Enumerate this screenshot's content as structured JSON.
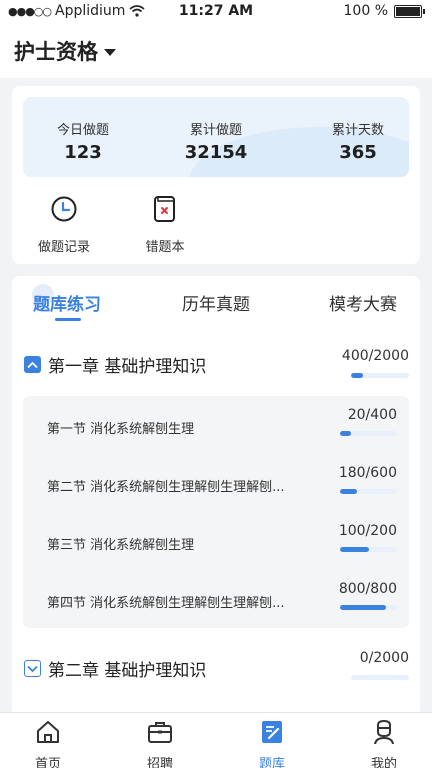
{
  "status_bar": {
    "carrier": "Applidium",
    "time": "11:27 AM",
    "battery": "100 %"
  },
  "header": {
    "title": "护士资格"
  },
  "stats": [
    {
      "label": "今日做题",
      "value": "123"
    },
    {
      "label": "累计做题",
      "value": "32154"
    },
    {
      "label": "累计天数",
      "value": "365"
    }
  ],
  "tools": [
    {
      "label": "做题记录",
      "icon": "clock-icon"
    },
    {
      "label": "错题本",
      "icon": "wrong-book-icon"
    }
  ],
  "tabs": [
    {
      "label": "题库练习",
      "active": true
    },
    {
      "label": "历年真题",
      "active": false
    },
    {
      "label": "模考大赛",
      "active": false
    }
  ],
  "chapters": [
    {
      "title": "第一章 基础护理知识",
      "progress": "400/2000",
      "fraction": 0.2,
      "expanded": true,
      "sections": [
        {
          "title": "第一节 消化系统解刨生理",
          "progress": "20/400",
          "fraction": 0.2
        },
        {
          "title": "第二节 消化系统解刨生理解刨生理解刨...",
          "progress": "180/600",
          "fraction": 0.3
        },
        {
          "title": "第三节 消化系统解刨生理",
          "progress": "100/200",
          "fraction": 0.5
        },
        {
          "title": "第四节 消化系统解刨生理解刨生理解刨...",
          "progress": "800/800",
          "fraction": 0.8
        }
      ]
    },
    {
      "title": "第二章 基础护理知识",
      "progress": "0/2000",
      "fraction": 0.0,
      "expanded": false
    }
  ],
  "tabbar": [
    {
      "label": "首页",
      "icon": "home-icon",
      "active": false
    },
    {
      "label": "招聘",
      "icon": "briefcase-icon",
      "active": false
    },
    {
      "label": "题库",
      "icon": "question-bank-icon",
      "active": true
    },
    {
      "label": "我的",
      "icon": "profile-icon",
      "active": false
    }
  ],
  "colors": {
    "accent": "#3b82e0",
    "light_bar": "#e7f0fb",
    "stats_bg": "#eaf3fc"
  }
}
